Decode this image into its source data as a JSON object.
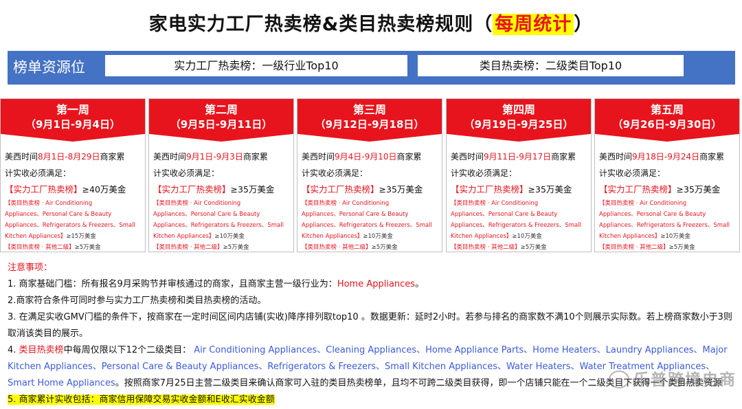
{
  "title": {
    "main": "家电实力工厂热卖榜&类目热卖榜规则（",
    "highlight": "每周统计",
    "end": "）"
  },
  "band": {
    "label": "榜单资源位",
    "box1": "实力工厂热卖榜：一级行业Top10",
    "box2": "类目热卖榜：二级类目Top10"
  },
  "common": {
    "prefix": "美西时间",
    "suffix": "商家累",
    "line2": "计实收必须满足：",
    "factory_label": "【实力工厂热卖榜】",
    "cat_label": "【类目热卖榜 · Air Conditioning",
    "cat_line2": "Appliances、Personal Care & Beauty",
    "cat_line3": "Appliances、Refrigerators & Freezers、Small",
    "cat_line4_prefix": "Kitchen Appliances】",
    "other_label": "【类目热卖榜 · 其他二级】",
    "other_value": "≥5万美金"
  },
  "weeks": [
    {
      "name": "第一周",
      "dates": "（9月1日-9月4日）",
      "range": "8月1日-8月29日",
      "factory_value": "≥40万美金",
      "cat_value": "≥15万美金"
    },
    {
      "name": "第二周",
      "dates": "（9月5日-9月11日）",
      "range": "9月1日-9月3日",
      "factory_value": "≥35万美金",
      "cat_value": "≥10万美金"
    },
    {
      "name": "第三周",
      "dates": "（9月12日-9月18日）",
      "range": "9月4日-9月10日",
      "factory_value": "≥35万美金",
      "cat_value": "≥10万美金"
    },
    {
      "name": "第四周",
      "dates": "（9月19日-9月25日）",
      "range": "9月11日-9月17日",
      "factory_value": "≥35万美金",
      "cat_value": "≥10万美金"
    },
    {
      "name": "第五周",
      "dates": "（9月26日-9月30日）",
      "range": "9月18日-9月24日",
      "factory_value": "≥35万美金",
      "cat_value": "≥10万美金"
    }
  ],
  "notes": {
    "heading": "注意事项：",
    "n1_text": "1. 商家基础门槛：所有报名9月采购节并审核通过的商家，且商家主营一级行业为：",
    "n1_red": "Home Appliances",
    "n1_end": "。",
    "n2": "2.商家符合条件可同时参与实力工厂热卖榜和类目热卖榜的活动。",
    "n3": "3. 在满足实收GMV门槛的条件下，按商家在一定时间区间内店铺(实收)降序排列取top10 。数据更新：延时2小时。若参与排名的商家数不满10个则展示实际数。若上榜商家数小于3则取消该类目的展示。",
    "n4_prefix": "4. ",
    "n4_red": "类目热卖榜",
    "n4_text": "中每周仅限以下12个二级类目：",
    "n4_blue": "Air Conditioning Appliances、Cleaning Appliances、Home Appliance Parts、Home Heaters、Laundry Appliances、Major Kitchen Appliances、Personal Care & Beauty Appliances、Refrigerators & Freezers、Small Kitchen Appliances、Water Heaters、Water Treatment Appliances、Smart Home Appliances",
    "n4_end": "。按照商家7月25日主营二级类目来确认商家可入驻的类目热卖榜单，且均不可跨二级类目获得，即一个店铺只能在一个二级类目下获得一个类目热卖资源",
    "n5": "5. 商家累计实收包括：商家信用保障交易实收金额和E收汇实收金额"
  },
  "watermark": "乐普跨境电商"
}
